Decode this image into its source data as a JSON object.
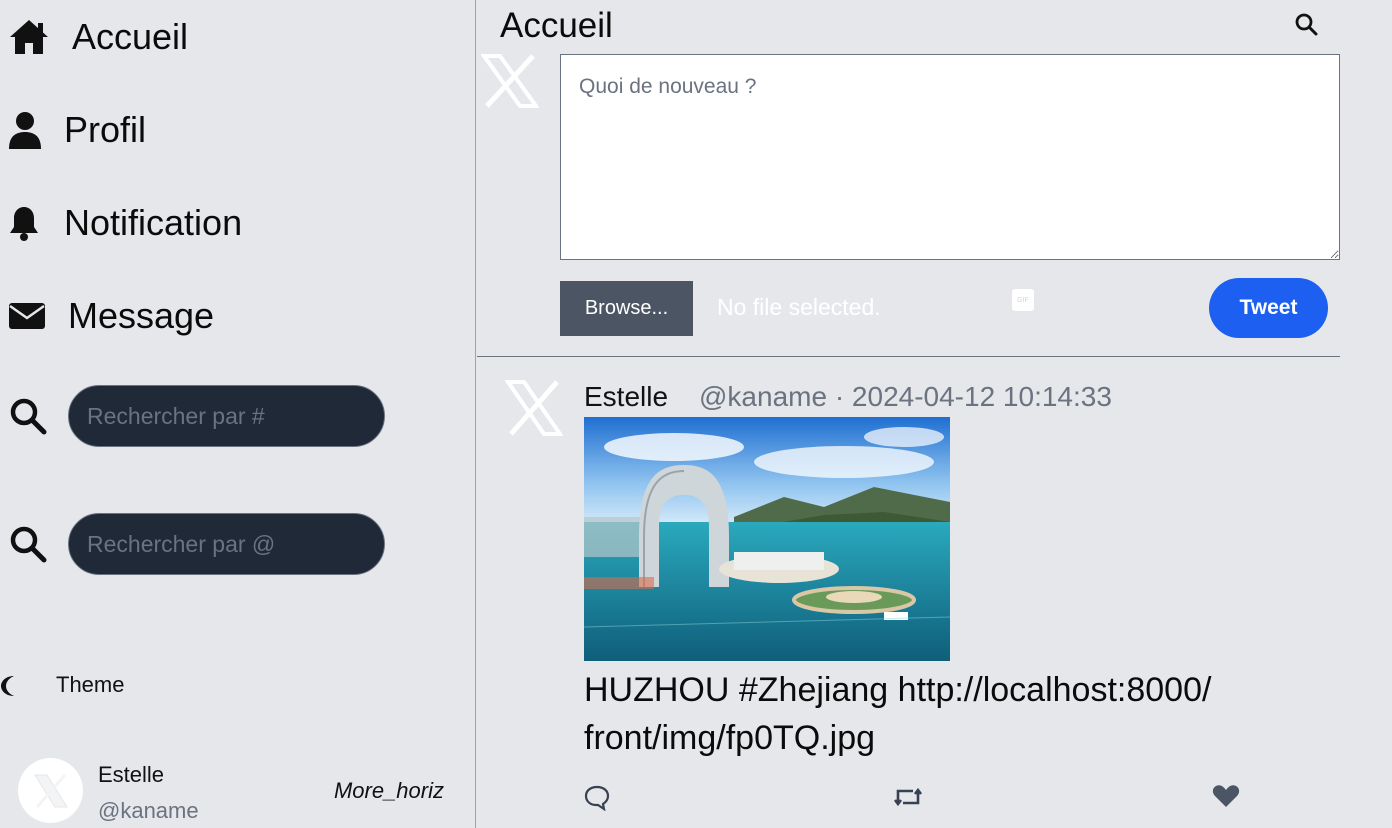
{
  "sidebar": {
    "nav": [
      {
        "label": "Accueil",
        "icon": "home-icon"
      },
      {
        "label": "Profil",
        "icon": "user-icon"
      },
      {
        "label": "Notification",
        "icon": "bell-icon"
      },
      {
        "label": "Message",
        "icon": "envelope-icon"
      }
    ],
    "search_hashtag_placeholder": "Rechercher par #",
    "search_user_placeholder": "Rechercher par @",
    "theme_label": "Theme",
    "profile": {
      "name": "Estelle",
      "handle": "@kaname",
      "more_label": "More_horiz"
    }
  },
  "main": {
    "title": "Accueil",
    "compose": {
      "placeholder": "Quoi de nouveau ?",
      "browse_label": "Browse...",
      "file_status": "No file selected.",
      "gif_label": "GIF",
      "tweet_label": "Tweet"
    },
    "tweet": {
      "author": "Estelle",
      "meta": "@kaname · 2024-04-12 10:14:33",
      "text": "HUZHOU #Zhejiang http://localhost:8000/\nfront/img/fp0TQ.jpg"
    }
  },
  "colors": {
    "background": "#e5e7eb",
    "search_bg": "#1f2937",
    "tweet_button": "#1d5ff0",
    "browse_button": "#4b5563",
    "muted_text": "#6b7280"
  }
}
